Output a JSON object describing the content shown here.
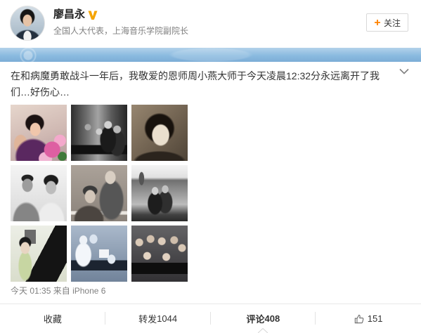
{
  "colors": {
    "accent_orange": "#ff8200",
    "verified_gold": "#f5a400",
    "text_primary": "#333333",
    "text_secondary": "#808080",
    "cover_blue": "#8bbbe0"
  },
  "user": {
    "name": "廖昌永",
    "badge_icon": "verified-v-icon",
    "bio": "全国人大代表，上海音乐学院副院长"
  },
  "follow_button": {
    "icon": "plus-icon",
    "label": "关注"
  },
  "post": {
    "menu_icon": "chevron-down-icon",
    "text": "在和病魔勇敢战斗一年后，我敬爱的恩师周小燕大师于今天凌晨12:32分永远离开了我们…好伤心…",
    "time": "今天 01:35",
    "source_prefix": "来自",
    "source": "iPhone 6"
  },
  "actions": [
    {
      "label": "收藏"
    },
    {
      "label": "转发",
      "count": "1044"
    },
    {
      "label": "评论",
      "count": "408",
      "active": true
    },
    {
      "icon": "thumbs-up-icon",
      "count": "151"
    }
  ]
}
